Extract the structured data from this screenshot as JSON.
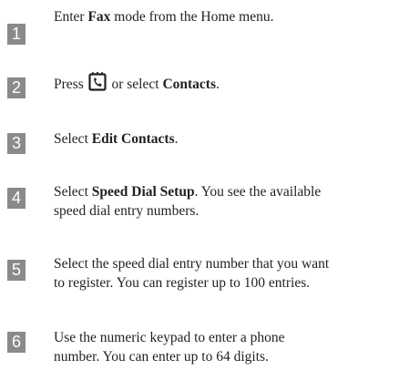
{
  "steps": [
    {
      "number": "1",
      "pre": "Enter ",
      "bold": "Fax",
      "post": " mode from the Home menu."
    },
    {
      "number": "2",
      "pre": "Press ",
      "icon": "contacts-phone-icon",
      "mid": " or select ",
      "bold": "Contacts",
      "post": "."
    },
    {
      "number": "3",
      "pre": "Select ",
      "bold": "Edit Contacts",
      "post": "."
    },
    {
      "number": "4",
      "pre": "Select ",
      "bold": "Speed Dial Setup",
      "post": ". You see the available",
      "line2": "speed dial entry numbers."
    },
    {
      "number": "5",
      "line1": "Select the speed dial entry number that you want",
      "line2": "to register. You can register up to 100 entries."
    },
    {
      "number": "6",
      "line1": "Use the numeric keypad to enter a phone",
      "line2": "number. You can enter up to 64 digits."
    }
  ]
}
